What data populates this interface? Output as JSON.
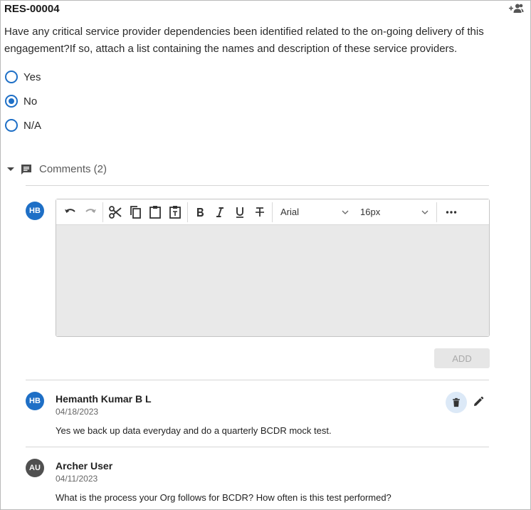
{
  "question": {
    "id": "RES-00004",
    "text": "Have any critical service provider dependencies been identified related to the on-going delivery of this engagement?If so, attach a list containing the names and description of these service providers.",
    "options": [
      {
        "label": "Yes",
        "selected": false
      },
      {
        "label": "No",
        "selected": true
      },
      {
        "label": "N/A",
        "selected": false
      }
    ]
  },
  "comments": {
    "header_label": "Comments (2)",
    "current_user_initials": "HB",
    "editor": {
      "font_family": "Arial",
      "font_size": "16px",
      "tools": [
        "undo-icon",
        "redo-icon",
        "cut-icon",
        "copy-icon",
        "paste-icon",
        "paste-text-icon",
        "bold-icon",
        "italic-icon",
        "underline-icon",
        "strikethrough-icon",
        "more-icon"
      ]
    },
    "add_label": "ADD",
    "items": [
      {
        "initials": "HB",
        "author": "Hemanth Kumar B L",
        "date": "04/18/2023",
        "text": "Yes we back up data everyday and do a quarterly BCDR mock test.",
        "avatar_color": "#1e6fc6"
      },
      {
        "initials": "AU",
        "author": "Archer User",
        "date": "04/11/2023",
        "text": "What is the process your Org follows for BCDR? How often is this test performed?",
        "avatar_color": "#505050"
      }
    ]
  },
  "colors": {
    "accent": "#1e6fc6",
    "editor_background": "#e9e9e9",
    "delete_highlight": "#dce9f7"
  }
}
